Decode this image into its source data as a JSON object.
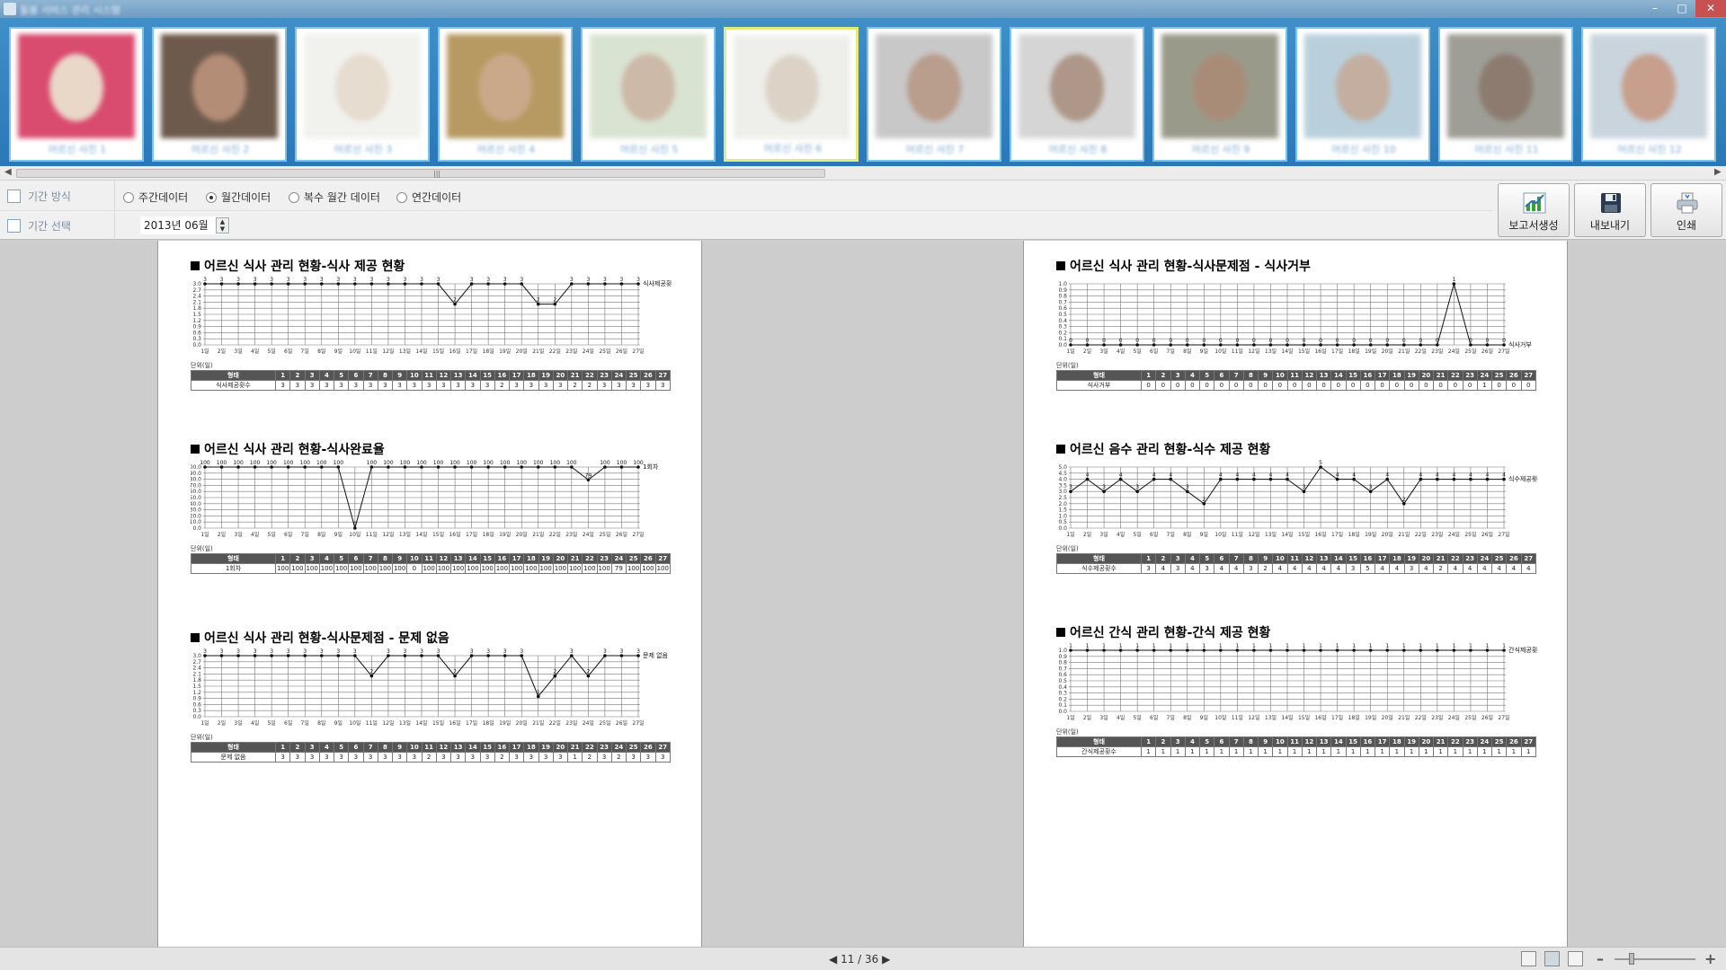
{
  "window": {
    "title": "돌봄 서비스 관리 시스템",
    "minimize_icon": "minimize-icon",
    "maximize_icon": "maximize-icon",
    "close_icon": "close-icon"
  },
  "residents": [
    {
      "caption": "어르신 사진 1",
      "photo_bg": "#d94b6f",
      "face": "#e9d7c8",
      "selected": false
    },
    {
      "caption": "어르신 사진 2",
      "photo_bg": "#6e5a4c",
      "face": "#b48d76",
      "selected": false
    },
    {
      "caption": "어르신 사진 3",
      "photo_bg": "#f1f1ee",
      "face": "#e6dccf",
      "selected": false
    },
    {
      "caption": "어르신 사진 4",
      "photo_bg": "#b79a62",
      "face": "#c9a98a",
      "selected": false
    },
    {
      "caption": "어르신 사진 5",
      "photo_bg": "#d9e3d2",
      "face": "#cdb9a7",
      "selected": false
    },
    {
      "caption": "어르신 사진 6",
      "photo_bg": "#eeeeea",
      "face": "#dcd3c6",
      "selected": true
    },
    {
      "caption": "어르신 사진 7",
      "photo_bg": "#c8c8c8",
      "face": "#b99d8d",
      "selected": false
    },
    {
      "caption": "어르신 사진 8",
      "photo_bg": "#d5d5d5",
      "face": "#ae9788",
      "selected": false
    },
    {
      "caption": "어르신 사진 9",
      "photo_bg": "#9a9a8a",
      "face": "#a98c78",
      "selected": false
    },
    {
      "caption": "어르신 사진 10",
      "photo_bg": "#b9d0dc",
      "face": "#c4aea0",
      "selected": false
    },
    {
      "caption": "어르신 사진 11",
      "photo_bg": "#9e9e96",
      "face": "#8d7b70",
      "selected": false
    },
    {
      "caption": "어르신 사진 12",
      "photo_bg": "#c9d4dd",
      "face": "#c79f8c",
      "selected": false
    }
  ],
  "toolbar": {
    "period_method_label": "기간 방식",
    "period_select_label": "기간 선택",
    "radios": [
      {
        "label": "주간데이터",
        "checked": false
      },
      {
        "label": "월간데이터",
        "checked": true
      },
      {
        "label": "복수 월간 데이터",
        "checked": false
      },
      {
        "label": "연간데이터",
        "checked": false
      }
    ],
    "date_value": "2013년 06월",
    "buttons": [
      {
        "label": "보고서생성",
        "icon": "report-chart-icon"
      },
      {
        "label": "내보내기",
        "icon": "floppy-disk-icon"
      },
      {
        "label": "인쇄",
        "icon": "printer-icon"
      }
    ]
  },
  "day_labels": [
    "1일",
    "2일",
    "3일",
    "4일",
    "5일",
    "6일",
    "7일",
    "8일",
    "9일",
    "10일",
    "11일",
    "12일",
    "13일",
    "14일",
    "15일",
    "16일",
    "17일",
    "18일",
    "19일",
    "20일",
    "21일",
    "22일",
    "23일",
    "24일",
    "25일",
    "26일",
    "27일"
  ],
  "table_days": [
    "1",
    "2",
    "3",
    "4",
    "5",
    "6",
    "7",
    "8",
    "9",
    "10",
    "11",
    "12",
    "13",
    "14",
    "15",
    "16",
    "17",
    "18",
    "19",
    "20",
    "21",
    "22",
    "23",
    "24",
    "25",
    "26",
    "27"
  ],
  "unit_label": "단위(일)",
  "type_label": "형태",
  "chart_data": [
    {
      "type": "line",
      "title": "어르신 식사 관리 현황-식사 제공 현황",
      "series": [
        {
          "name": "식사제공횟수",
          "values": [
            3,
            3,
            3,
            3,
            3,
            3,
            3,
            3,
            3,
            3,
            3,
            3,
            3,
            3,
            3,
            2,
            3,
            3,
            3,
            3,
            2,
            2,
            3,
            3,
            3,
            3,
            3
          ]
        }
      ],
      "ylim": [
        0,
        3.0
      ],
      "yticks": [
        "0.0",
        "0.3",
        "0.6",
        "0.9",
        "1.2",
        "1.5",
        "1.8",
        "2.1",
        "2.4",
        "2.7",
        "3.0"
      ],
      "table_row_label": "식사제공횟수",
      "table_values": [
        "3",
        "3",
        "3",
        "3",
        "3",
        "3",
        "3",
        "3",
        "3",
        "3",
        "3",
        "3",
        "3",
        "3",
        "3",
        "2",
        "3",
        "3",
        "3",
        "3",
        "2",
        "2",
        "3",
        "3",
        "3",
        "3",
        "3"
      ]
    },
    {
      "type": "line",
      "title": "어르신 식사 관리 현황-식사완료율",
      "series": [
        {
          "name": "1회차",
          "values": [
            100,
            100,
            100,
            100,
            100,
            100,
            100,
            100,
            100,
            0,
            100,
            100,
            100,
            100,
            100,
            100,
            100,
            100,
            100,
            100,
            100,
            100,
            100,
            79,
            100,
            100,
            100
          ]
        }
      ],
      "ylim": [
        0,
        100
      ],
      "yticks": [
        "0.0",
        "10.0",
        "20.0",
        "30.0",
        "40.0",
        "50.0",
        "60.0",
        "70.0",
        "80.0",
        "90.0",
        "100.0"
      ],
      "table_row_label": "1회차",
      "table_values": [
        "100",
        "100",
        "100",
        "100",
        "100",
        "100",
        "100",
        "100",
        "100",
        "0",
        "100",
        "100",
        "100",
        "100",
        "100",
        "100",
        "100",
        "100",
        "100",
        "100",
        "100",
        "100",
        "100",
        "79",
        "100",
        "100",
        "100"
      ]
    },
    {
      "type": "line",
      "title": "어르신 식사 관리 현황-식사문제점 - 문제 없음",
      "series": [
        {
          "name": "문제 없음",
          "values": [
            3,
            3,
            3,
            3,
            3,
            3,
            3,
            3,
            3,
            3,
            2,
            3,
            3,
            3,
            3,
            2,
            3,
            3,
            3,
            3,
            1,
            2,
            3,
            2,
            3,
            3,
            3
          ]
        }
      ],
      "ylim": [
        0,
        3.0
      ],
      "yticks": [
        "0.0",
        "0.3",
        "0.6",
        "0.9",
        "1.2",
        "1.5",
        "1.8",
        "2.1",
        "2.4",
        "2.7",
        "3.0"
      ],
      "table_row_label": "문제 없음",
      "table_values": [
        "3",
        "3",
        "3",
        "3",
        "3",
        "3",
        "3",
        "3",
        "3",
        "3",
        "2",
        "3",
        "3",
        "3",
        "3",
        "2",
        "3",
        "3",
        "3",
        "3",
        "1",
        "2",
        "3",
        "2",
        "3",
        "3",
        "3"
      ]
    },
    {
      "type": "line",
      "title": "어르신 식사 관리 현황-식사문제점 - 식사거부",
      "series": [
        {
          "name": "식사거부",
          "values": [
            0,
            0,
            0,
            0,
            0,
            0,
            0,
            0,
            0,
            0,
            0,
            0,
            0,
            0,
            0,
            0,
            0,
            0,
            0,
            0,
            0,
            0,
            0,
            1,
            0,
            0,
            0
          ]
        }
      ],
      "ylim": [
        0,
        1.0
      ],
      "yticks": [
        "0.0",
        "0.1",
        "0.2",
        "0.3",
        "0.4",
        "0.5",
        "0.6",
        "0.7",
        "0.8",
        "0.9",
        "1.0"
      ],
      "table_row_label": "식사거부",
      "table_values": [
        "0",
        "0",
        "0",
        "0",
        "0",
        "0",
        "0",
        "0",
        "0",
        "0",
        "0",
        "0",
        "0",
        "0",
        "0",
        "0",
        "0",
        "0",
        "0",
        "0",
        "0",
        "0",
        "0",
        "1",
        "0",
        "0",
        "0"
      ]
    },
    {
      "type": "line",
      "title": "어르신 음수 관리 현황-식수 제공 현황",
      "series": [
        {
          "name": "식수제공횟수",
          "values": [
            3,
            4,
            3,
            4,
            3,
            4,
            4,
            3,
            2,
            4,
            4,
            4,
            4,
            4,
            3,
            5,
            4,
            4,
            3,
            4,
            2,
            4,
            4,
            4,
            4,
            4,
            4
          ]
        }
      ],
      "ylim": [
        0,
        5.0
      ],
      "yticks": [
        "0.0",
        "0.5",
        "1.0",
        "1.5",
        "2.0",
        "2.5",
        "3.0",
        "3.5",
        "4.0",
        "4.5",
        "5.0"
      ],
      "table_row_label": "식수제공횟수",
      "table_values": [
        "3",
        "4",
        "3",
        "4",
        "3",
        "4",
        "4",
        "3",
        "2",
        "4",
        "4",
        "4",
        "4",
        "4",
        "3",
        "5",
        "4",
        "4",
        "3",
        "4",
        "2",
        "4",
        "4",
        "4",
        "4",
        "4",
        "4"
      ]
    },
    {
      "type": "line",
      "title": "어르신 간식 관리 현황-간식 제공 현황",
      "series": [
        {
          "name": "간식제공횟수",
          "values": [
            1,
            1,
            1,
            1,
            1,
            1,
            1,
            1,
            1,
            1,
            1,
            1,
            1,
            1,
            1,
            1,
            1,
            1,
            1,
            1,
            1,
            1,
            1,
            1,
            1,
            1,
            1
          ]
        }
      ],
      "ylim": [
        0,
        1.0
      ],
      "yticks": [
        "0.0",
        "0.1",
        "0.2",
        "0.3",
        "0.4",
        "0.5",
        "0.6",
        "0.7",
        "0.8",
        "0.9",
        "1.0"
      ],
      "table_row_label": "간식제공횟수",
      "table_values": [
        "1",
        "1",
        "1",
        "1",
        "1",
        "1",
        "1",
        "1",
        "1",
        "1",
        "1",
        "1",
        "1",
        "1",
        "1",
        "1",
        "1",
        "1",
        "1",
        "1",
        "1",
        "1",
        "1",
        "1",
        "1",
        "1",
        "1"
      ]
    }
  ],
  "status": {
    "page": "11",
    "sep": "/",
    "total": "36"
  }
}
